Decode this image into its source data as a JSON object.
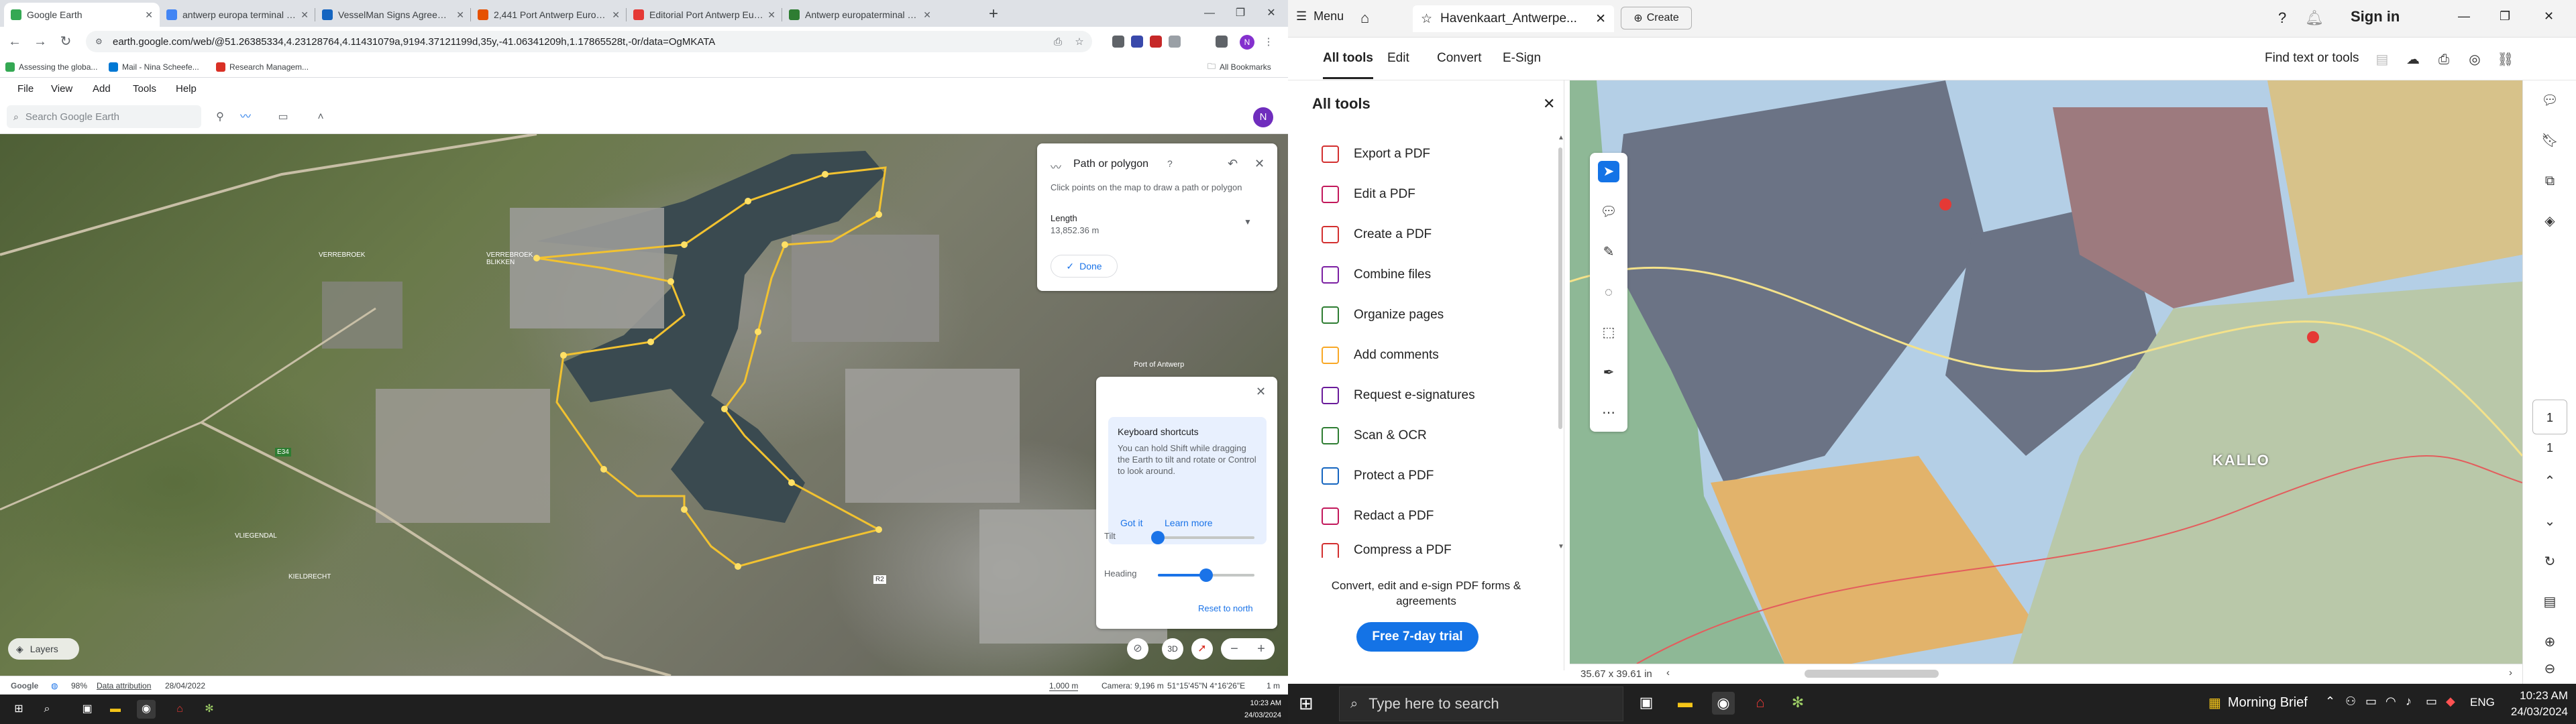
{
  "chrome": {
    "tabs": [
      {
        "title": "Google Earth",
        "color": "#34a853"
      },
      {
        "title": "antwerp europa terminal rono...",
        "color": "#4285f4"
      },
      {
        "title": "VesselMan Signs Agreement w...",
        "color": "#1565c0"
      },
      {
        "title": "2,441 Port Antwerp Europa Imag...",
        "color": "#e65100"
      },
      {
        "title": "Editorial Port Antwerp Europa ...",
        "color": "#e53935"
      },
      {
        "title": "Antwerp europaterminal hi-res...",
        "color": "#2e7d32"
      }
    ],
    "new_tab": "+",
    "url": "earth.google.com/web/@51.26385334,4.23128764,4.11431079a,9194.37121199d,35y,-41.06341209h,1.17865528t,-0r/data=OgMKATA",
    "bookmarks": [
      {
        "label": "Assessing the globa...",
        "color": "#34a853"
      },
      {
        "label": "Mail - Nina Scheefe...",
        "color": "#0078d4"
      },
      {
        "label": "Research Managem...",
        "color": "#d93025"
      }
    ],
    "all_bookmarks": "All Bookmarks",
    "profile_initial": "N"
  },
  "earth": {
    "menu": [
      "File",
      "View",
      "Add",
      "Tools",
      "Help"
    ],
    "search_placeholder": "Search Google Earth",
    "avatar_initial": "N",
    "path_panel": {
      "title": "Path or polygon",
      "hint": "Click points on the map to draw a path or polygon",
      "length_label": "Length",
      "length_value": "13,852.36 m",
      "done": "Done"
    },
    "shortcuts_panel": {
      "title": "Keyboard shortcuts",
      "body": "You can hold Shift while dragging the Earth to tilt and rotate or Control to look around.",
      "got_it": "Got it",
      "learn_more": "Learn more",
      "tilt_label": "Tilt",
      "heading_label": "Heading",
      "reset": "Reset to north",
      "tilt_level": 0.0,
      "heading_level": 0.5
    },
    "btn_3d": "3D",
    "layers": "Layers",
    "labels": [
      "VERREBROEK",
      "VERREBROEK BLIKKEN",
      "Port of Antwerp",
      "VLIEGENDAL",
      "KIELDRECHT",
      "E34",
      "R2"
    ],
    "status": {
      "brand": "Google",
      "pct": "98%",
      "attribution": "Data attribution",
      "date": "28/04/2022",
      "scale": "1,000 m",
      "camera": "Camera: 9,196 m",
      "coords": "51°15'45\"N 4°16'26\"E",
      "elev": "1 m"
    }
  },
  "taskbar_left": {
    "time": "10:23 AM",
    "date": "24/03/2024"
  },
  "acrobat": {
    "menu": "Menu",
    "tab_title": "Havenkaart_Antwerpe...",
    "create": "Create",
    "signin": "Sign in",
    "tabs": [
      "All tools",
      "Edit",
      "Convert",
      "E-Sign"
    ],
    "find": "Find text or tools",
    "tools_title": "All tools",
    "tools": [
      {
        "label": "Export a PDF",
        "color": "#d32f2f"
      },
      {
        "label": "Edit a PDF",
        "color": "#c2185b"
      },
      {
        "label": "Create a PDF",
        "color": "#d32f2f"
      },
      {
        "label": "Combine files",
        "color": "#7b1fa2"
      },
      {
        "label": "Organize pages",
        "color": "#2e7d32"
      },
      {
        "label": "Add comments",
        "color": "#f9a825"
      },
      {
        "label": "Request e-signatures",
        "color": "#6a1b9a"
      },
      {
        "label": "Scan & OCR",
        "color": "#2e7d32"
      },
      {
        "label": "Protect a PDF",
        "color": "#1565c0"
      },
      {
        "label": "Redact a PDF",
        "color": "#c2185b"
      },
      {
        "label": "Compress a PDF",
        "color": "#d32f2f"
      }
    ],
    "promo": "Convert, edit and e-sign PDF forms & agreements",
    "trial": "Free 7-day trial",
    "map_label": "KALLO",
    "page_current": "1",
    "page_total": "1",
    "doc_size": "35.67 x 39.61 in"
  },
  "taskbar_right": {
    "search_placeholder": "Type here to search",
    "weather": "Morning Brief",
    "lang": "ENG",
    "time": "10:23 AM",
    "date": "24/03/2024"
  }
}
